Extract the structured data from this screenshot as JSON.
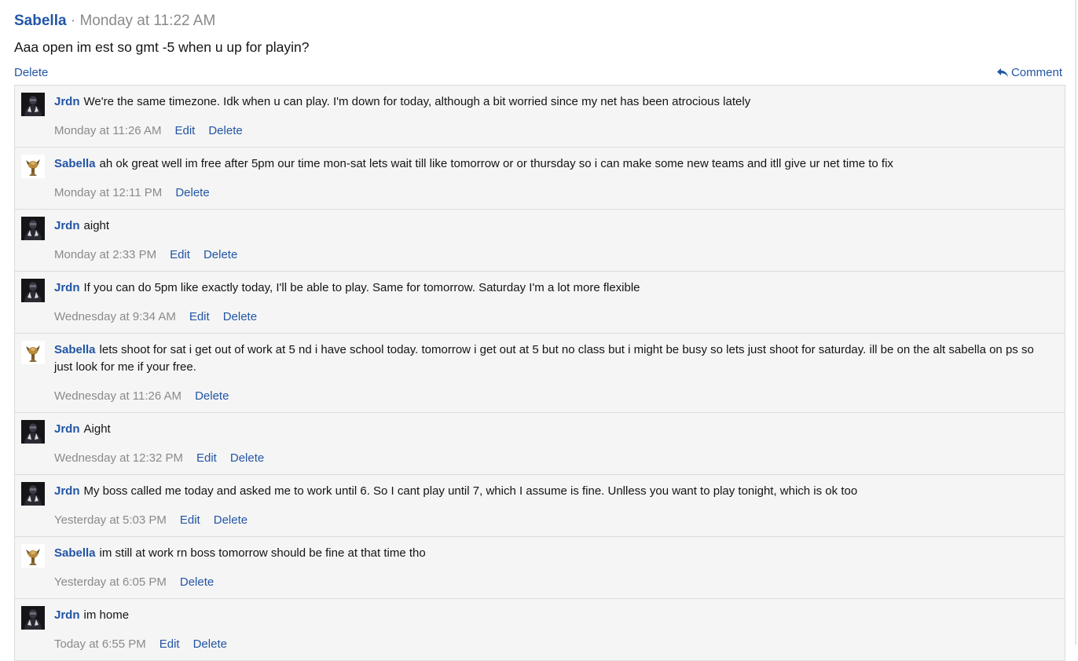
{
  "post": {
    "author": "Sabella",
    "separator": "·",
    "time": "Monday at 11:22 AM",
    "body": "Aaa open im est so gmt -5 when u up for playin?",
    "delete_label": "Delete",
    "comment_label": "Comment",
    "comment_icon": "reply-icon"
  },
  "colors": {
    "link": "#2255a5",
    "meta": "#8a8a8a",
    "comment_bg": "#f5f5f5",
    "border": "#dcdcdc"
  },
  "comments": [
    {
      "author": "Jrdn",
      "avatar": "jrdn-avatar",
      "text": "We're the same timezone. Idk when u can play. I'm down for today, although a bit worried since my net has been atrocious lately",
      "time": "Monday at 11:26 AM",
      "edit": "Edit",
      "delete": "Delete"
    },
    {
      "author": "Sabella",
      "avatar": "sabella-avatar",
      "text": "ah ok great well im free after 5pm our time mon-sat lets wait till like tomorrow or or thursday so i can make some new teams and itll give ur net time to fix",
      "time": "Monday at 12:11 PM",
      "delete": "Delete"
    },
    {
      "author": "Jrdn",
      "avatar": "jrdn-avatar",
      "text": "aight",
      "time": "Monday at 2:33 PM",
      "edit": "Edit",
      "delete": "Delete"
    },
    {
      "author": "Jrdn",
      "avatar": "jrdn-avatar",
      "text": "If you can do 5pm like exactly today, I'll be able to play. Same for tomorrow. Saturday I'm a lot more flexible",
      "time": "Wednesday at 9:34 AM",
      "edit": "Edit",
      "delete": "Delete"
    },
    {
      "author": "Sabella",
      "avatar": "sabella-avatar",
      "text": "lets shoot for sat i get out of work at 5 nd i have school today. tomorrow i get out at 5 but no class but i might be busy so lets just shoot for saturday. ill be on the alt sabella on ps so just look for me if your free.",
      "time": "Wednesday at 11:26 AM",
      "delete": "Delete"
    },
    {
      "author": "Jrdn",
      "avatar": "jrdn-avatar",
      "text": "Aight",
      "time": "Wednesday at 12:32 PM",
      "edit": "Edit",
      "delete": "Delete"
    },
    {
      "author": "Jrdn",
      "avatar": "jrdn-avatar",
      "text": "My boss called me today and asked me to work until 6. So I cant play until 7, which I assume is fine. Unlless you want to play tonight, which is ok too",
      "time": "Yesterday at 5:03 PM",
      "edit": "Edit",
      "delete": "Delete"
    },
    {
      "author": "Sabella",
      "avatar": "sabella-avatar",
      "text": "im still at work rn boss tomorrow should be fine at that time tho",
      "time": "Yesterday at 6:05 PM",
      "delete": "Delete"
    },
    {
      "author": "Jrdn",
      "avatar": "jrdn-avatar",
      "text": "im home",
      "time": "Today at 6:55 PM",
      "edit": "Edit",
      "delete": "Delete"
    }
  ]
}
